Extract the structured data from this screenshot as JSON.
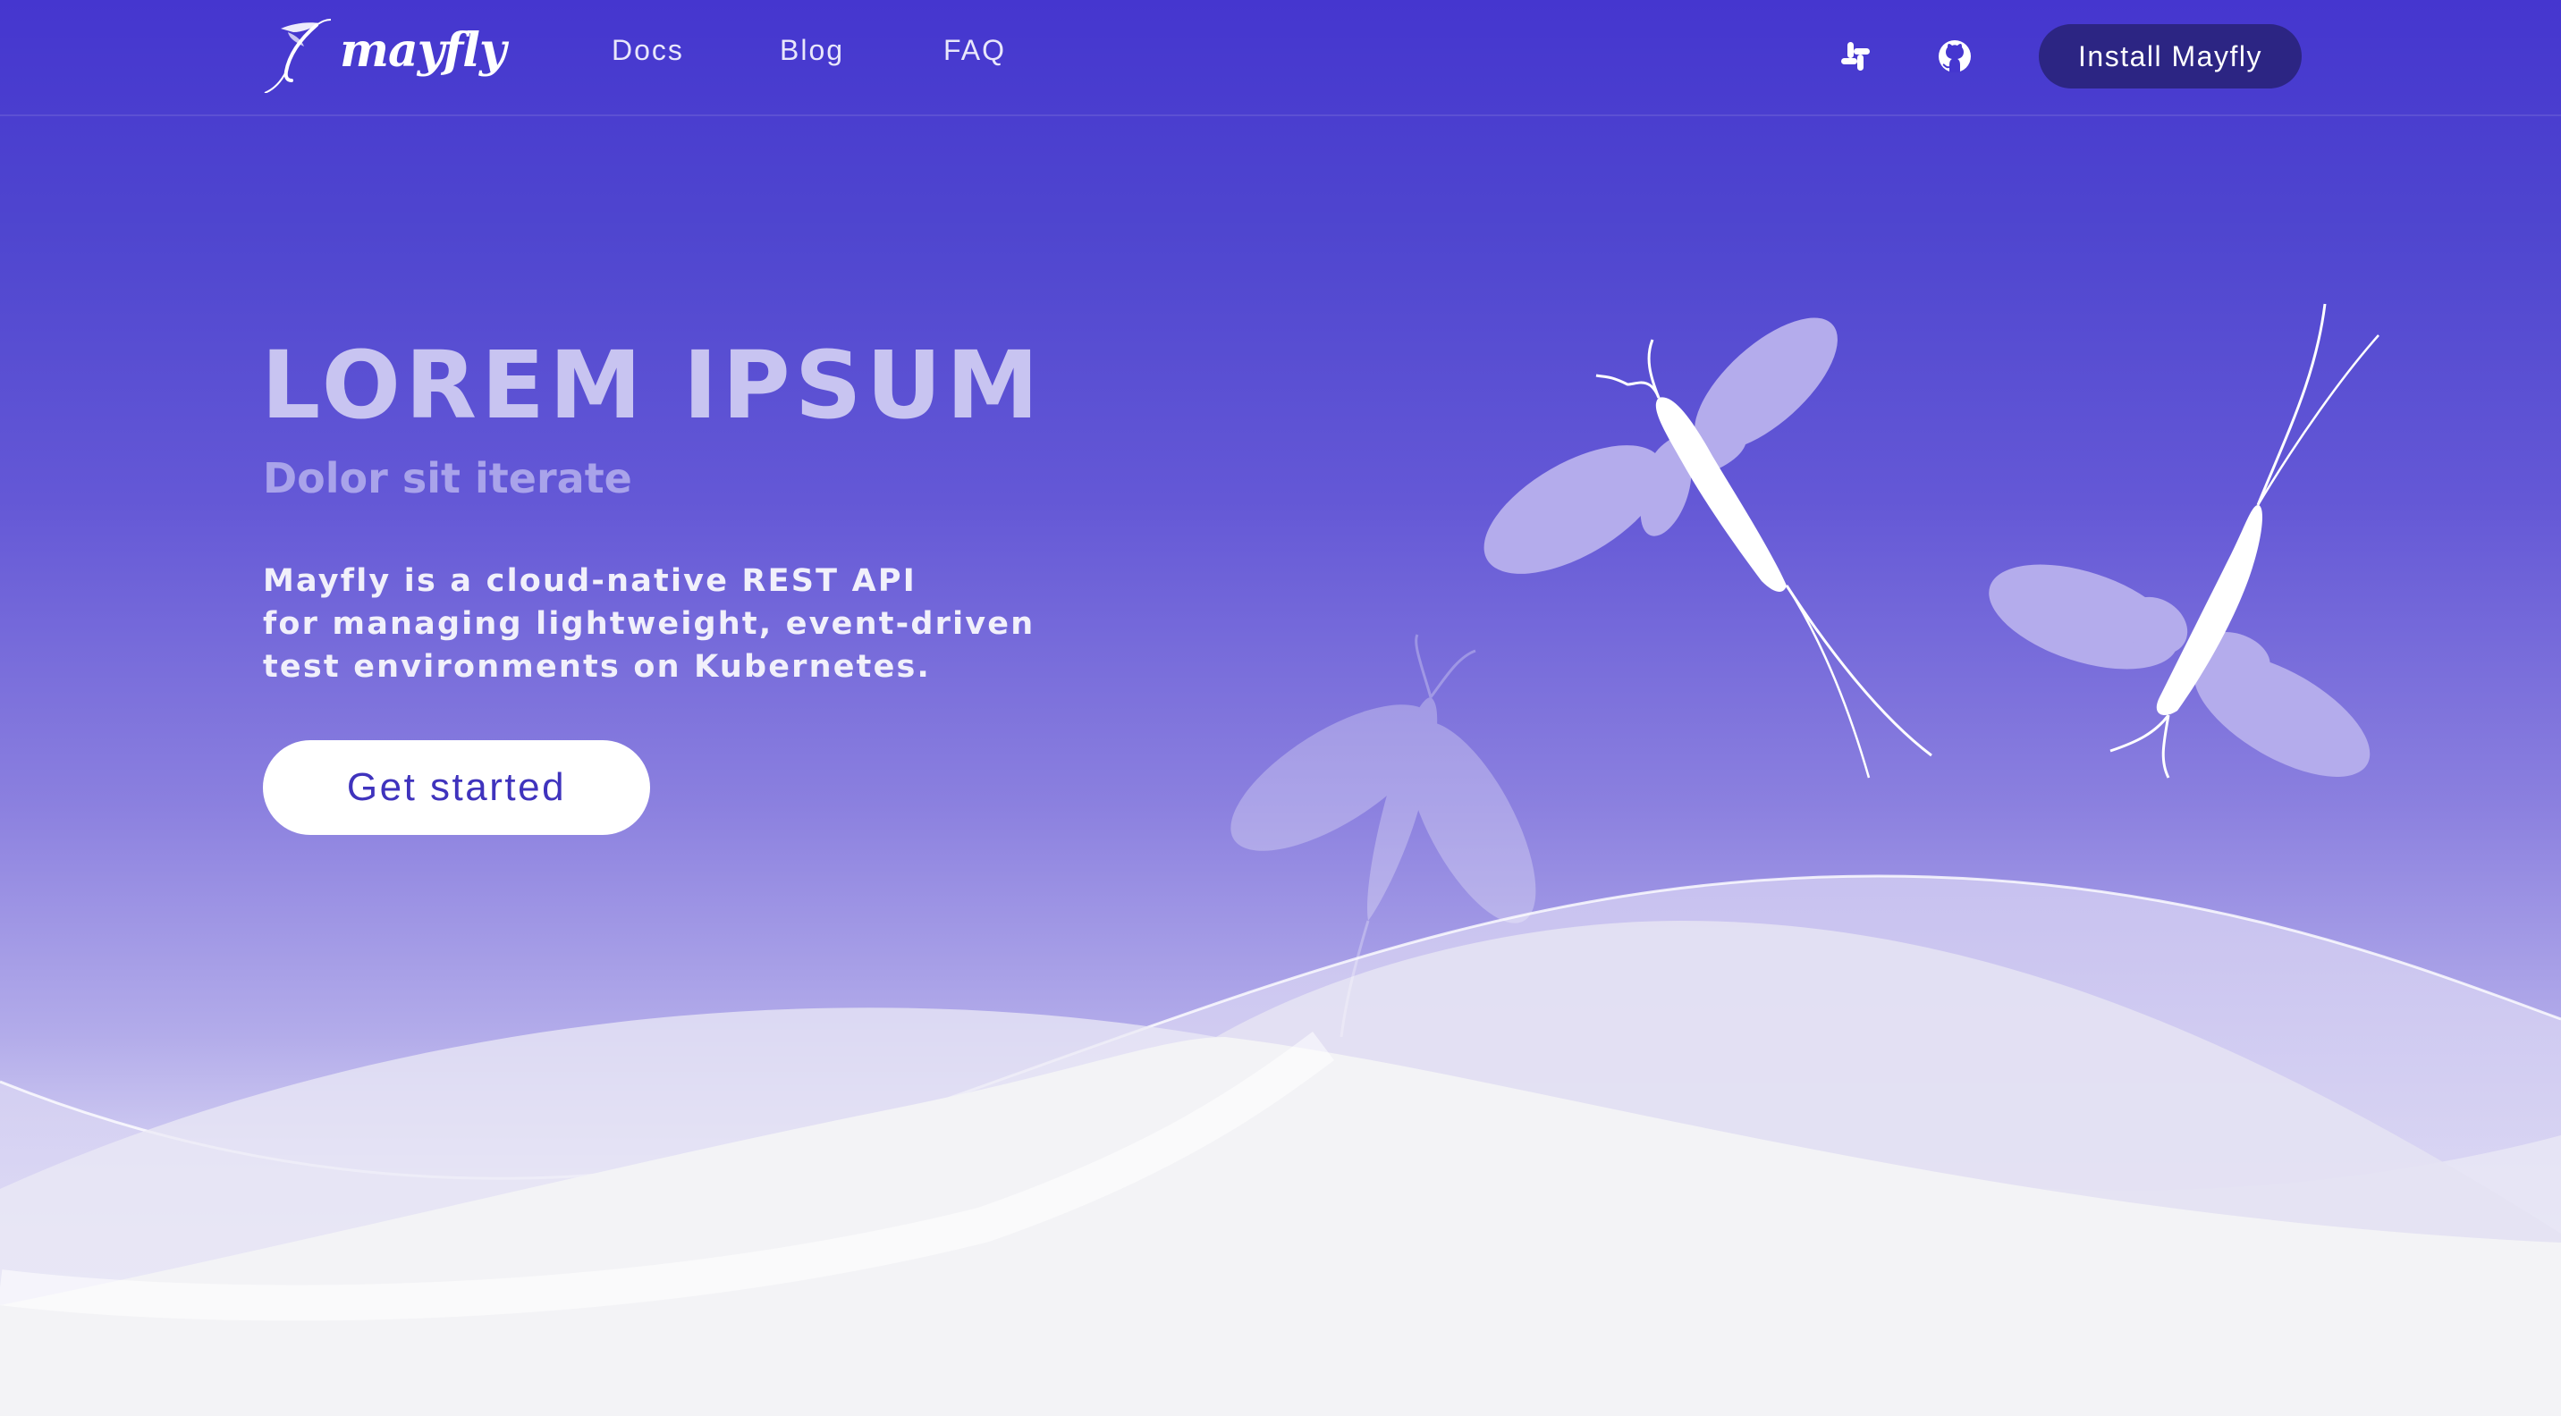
{
  "nav": {
    "logo_text": "mayfly",
    "logo_icon": "mayfly-logo-icon",
    "links": [
      {
        "label": "Docs"
      },
      {
        "label": "Blog"
      },
      {
        "label": "FAQ"
      }
    ],
    "icons": [
      "slack-icon",
      "github-icon"
    ],
    "install_label": "Install Mayfly"
  },
  "hero": {
    "title": "LOREM IPSUM",
    "subtitle": "Dolor sit iterate",
    "description_lines": [
      "Mayfly is a cloud-native REST API",
      "for managing lightweight, event-driven",
      "test environments on Kubernetes."
    ],
    "cta_label": "Get started"
  },
  "colors": {
    "brand_purple": "#4536cf",
    "install_button": "#2c2583",
    "cta_text": "#3f33bd",
    "title_text": "#c8c4f1"
  }
}
